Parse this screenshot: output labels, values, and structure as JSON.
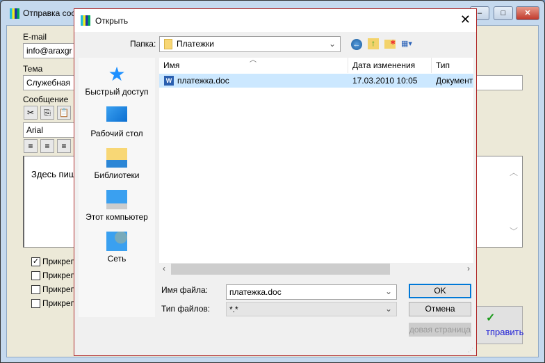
{
  "main_window": {
    "title": "Отправка соо",
    "email_label": "E-mail",
    "email_value": "info@araxgr",
    "subject_label": "Тема",
    "subject_value": "Служебная",
    "message_label": "Сообщение",
    "font_value": "Arial",
    "message_text": "Здесь пиш",
    "attachments": [
      {
        "label": "Прикреп",
        "checked": true
      },
      {
        "label": "Прикреп",
        "checked": false
      },
      {
        "label": "Прикреп",
        "checked": false
      },
      {
        "label": "Прикреп",
        "checked": false
      }
    ],
    "send_label": "тправить"
  },
  "dialog": {
    "title": "Открыть",
    "folder_label": "Папка:",
    "folder_value": "Платежки",
    "places": [
      {
        "label": "Быстрый доступ",
        "icon": "star-icon"
      },
      {
        "label": "Рабочий стол",
        "icon": "desktop-icon"
      },
      {
        "label": "Библиотеки",
        "icon": "library-icon"
      },
      {
        "label": "Этот компьютер",
        "icon": "computer-icon"
      },
      {
        "label": "Сеть",
        "icon": "network-icon"
      }
    ],
    "columns": [
      "Имя",
      "Дата изменения",
      "Тип"
    ],
    "files": [
      {
        "name": "платежка.doc",
        "date": "17.03.2010 10:05",
        "type": "Документ"
      }
    ],
    "filename_label": "Имя файла:",
    "filename_value": "платежка.doc",
    "filetype_label": "Тип файлов:",
    "filetype_value": "*.*",
    "ok_label": "OK",
    "cancel_label": "Отмена",
    "codepage_label": "одовая страница."
  },
  "colors": {
    "selection": "#cce8ff",
    "dialog_border": "#b02a2a",
    "accent": "#0078d7"
  }
}
